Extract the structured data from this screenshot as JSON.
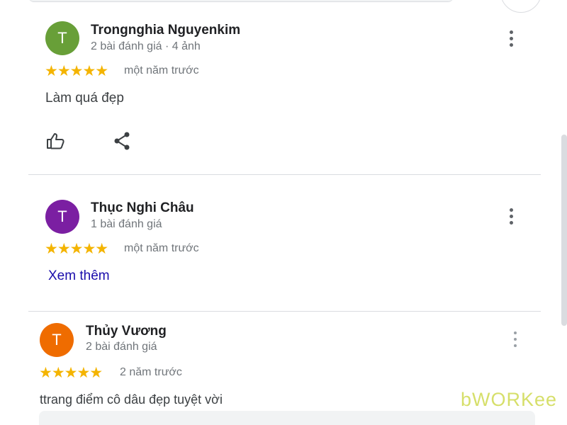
{
  "reviews": [
    {
      "avatar_letter": "T",
      "avatar_color": "#689f38",
      "name": "Trongnghia Nguyenkim",
      "meta": "2 bài đánh giá · 4 ảnh",
      "stars": "★★★★★",
      "rating": 5,
      "time": "một năm trước",
      "text": "Làm quá đẹp",
      "actions": [
        "thumbs-up-icon",
        "share-icon"
      ]
    },
    {
      "avatar_letter": "T",
      "avatar_color": "#7b1fa2",
      "name": "Thục Nghi Châu",
      "meta": "1 bài đánh giá",
      "stars": "★★★★★",
      "rating": 5,
      "time": "một năm trước",
      "more_link": "Xem thêm"
    },
    {
      "avatar_letter": "T",
      "avatar_color": "#ef6c00",
      "name": "Thủy Vương",
      "meta": "2 bài đánh giá",
      "stars": "★★★★★",
      "rating": 5,
      "time": "2 năm trước",
      "text": "ttrang điểm cô dâu đẹp tuyệt vời"
    }
  ],
  "watermark": "bWORKee",
  "colors": {
    "star": "#f4b400",
    "link": "#1a0dab",
    "divider": "#dadce0"
  }
}
